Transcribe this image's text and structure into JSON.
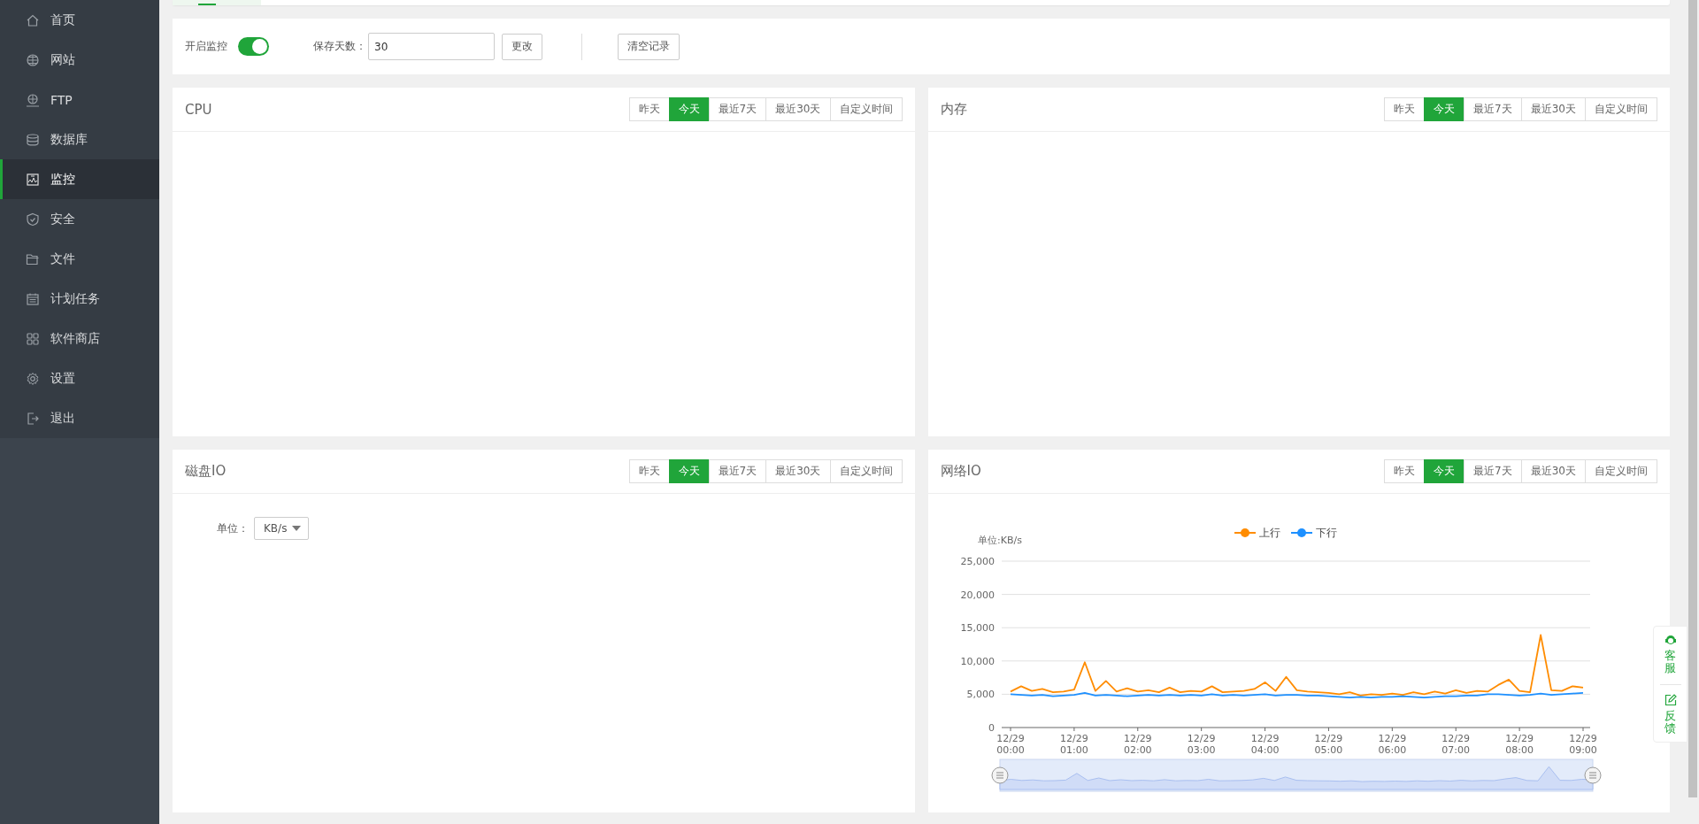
{
  "sidebar": {
    "items": [
      {
        "label": "首页",
        "selected": false
      },
      {
        "label": "网站",
        "selected": false
      },
      {
        "label": "FTP",
        "selected": false
      },
      {
        "label": "数据库",
        "selected": false
      },
      {
        "label": "监控",
        "selected": true
      },
      {
        "label": "安全",
        "selected": false
      },
      {
        "label": "文件",
        "selected": false
      },
      {
        "label": "计划任务",
        "selected": false
      },
      {
        "label": "软件商店",
        "selected": false
      },
      {
        "label": "设置",
        "selected": false
      },
      {
        "label": "退出",
        "selected": false
      }
    ]
  },
  "controls": {
    "monitor_label": "开启监控",
    "monitor_on": true,
    "days_label": "保存天数：",
    "days_value": "30",
    "change_button": "更改",
    "clear_button": "清空记录"
  },
  "panels": [
    {
      "title": "CPU",
      "kind": "empty",
      "ranges": [
        {
          "label": "昨天",
          "selected": false
        },
        {
          "label": "今天",
          "selected": true
        },
        {
          "label": "最近7天",
          "selected": false
        },
        {
          "label": "最近30天",
          "selected": false
        },
        {
          "label": "自定义时间",
          "selected": false
        }
      ]
    },
    {
      "title": "内存",
      "kind": "empty",
      "ranges": [
        {
          "label": "昨天",
          "selected": false
        },
        {
          "label": "今天",
          "selected": true
        },
        {
          "label": "最近7天",
          "selected": false
        },
        {
          "label": "最近30天",
          "selected": false
        },
        {
          "label": "自定义时间",
          "selected": false
        }
      ]
    },
    {
      "title": "磁盘IO",
      "kind": "unit",
      "unit_label": "单位：",
      "unit_value": "KB/s",
      "ranges": [
        {
          "label": "昨天",
          "selected": false
        },
        {
          "label": "今天",
          "selected": true
        },
        {
          "label": "最近7天",
          "selected": false
        },
        {
          "label": "最近30天",
          "selected": false
        },
        {
          "label": "自定义时间",
          "selected": false
        }
      ]
    },
    {
      "title": "网络IO",
      "kind": "chart",
      "ranges": [
        {
          "label": "昨天",
          "selected": false
        },
        {
          "label": "今天",
          "selected": true
        },
        {
          "label": "最近7天",
          "selected": false
        },
        {
          "label": "最近30天",
          "selected": false
        },
        {
          "label": "自定义时间",
          "selected": false
        }
      ],
      "chart_data": {
        "type": "line",
        "ylabel": "单位:KB/s",
        "ylim": [
          0,
          25000
        ],
        "grid": true,
        "legend": "top",
        "yticks": [
          {
            "value": 0,
            "label": "0"
          },
          {
            "value": 5000,
            "label": "5,000"
          },
          {
            "value": 10000,
            "label": "10,000"
          },
          {
            "value": 15000,
            "label": "15,000"
          },
          {
            "value": 20000,
            "label": "20,000"
          },
          {
            "value": 25000,
            "label": "25,000"
          }
        ],
        "categories": [
          "12/29 00:00",
          null,
          null,
          null,
          null,
          null,
          "12/29 01:00",
          null,
          null,
          null,
          null,
          null,
          "12/29 02:00",
          null,
          null,
          null,
          null,
          null,
          "12/29 03:00",
          null,
          null,
          null,
          null,
          null,
          "12/29 04:00",
          null,
          null,
          null,
          null,
          null,
          "12/29 05:00",
          null,
          null,
          null,
          null,
          null,
          "12/29 06:00",
          null,
          null,
          null,
          null,
          null,
          "12/29 07:00",
          null,
          null,
          null,
          null,
          null,
          "12/29 08:00",
          null,
          null,
          null,
          null,
          null,
          "12/29 09:00"
        ],
        "series": [
          {
            "name": "上行",
            "color": "#ff8c00",
            "values": [
              5400,
              6200,
              5500,
              5800,
              5300,
              5400,
              5700,
              9800,
              5500,
              7000,
              5400,
              5900,
              5400,
              5600,
              5300,
              6000,
              5300,
              5500,
              5400,
              6200,
              5300,
              5400,
              5500,
              5800,
              6800,
              5500,
              7600,
              5600,
              5400,
              5300,
              5200,
              5000,
              5300,
              4800,
              5000,
              4900,
              5100,
              4900,
              5300,
              5000,
              5400,
              5100,
              5600,
              5200,
              5500,
              5400,
              6400,
              7200,
              5500,
              5300,
              13900,
              5600,
              5500,
              6200,
              6000
            ]
          },
          {
            "name": "下行",
            "color": "#1e90ff",
            "values": [
              5000,
              4900,
              4800,
              4900,
              4700,
              4800,
              4900,
              5200,
              4800,
              4900,
              4800,
              4700,
              4800,
              4900,
              4800,
              4900,
              4800,
              4900,
              4800,
              5000,
              4800,
              4900,
              4800,
              4900,
              5000,
              4800,
              4900,
              4900,
              4800,
              4800,
              4700,
              4600,
              4500,
              4600,
              4500,
              4600,
              4600,
              4700,
              4600,
              4500,
              4600,
              4700,
              4700,
              4800,
              4800,
              5000,
              5000,
              4900,
              4800,
              4900,
              5100,
              4900,
              5000,
              5100,
              5200
            ]
          }
        ]
      }
    }
  ],
  "float_panel": {
    "items": [
      "客服",
      "反馈"
    ]
  }
}
